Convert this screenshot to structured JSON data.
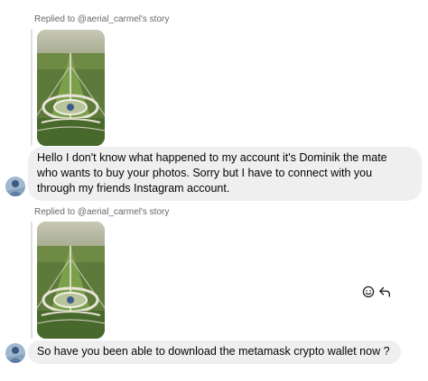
{
  "messages": [
    {
      "reply_label": "Replied to @aerial_carmel's story",
      "story_image": "aerial-park-photo",
      "text": "Hello I don't know what happened to my account it's Dominik the mate who wants to buy your photos. Sorry but I have to connect with you through my friends Instagram account.",
      "avatar": "user-avatar"
    },
    {
      "reply_label": "Replied to @aerial_carmel's story",
      "story_image": "aerial-park-photo",
      "text": "So have you been able to download the metamask crypto wallet now ?",
      "avatar": "user-avatar",
      "actions": [
        "emoji-react-icon",
        "reply-arrow-icon"
      ]
    }
  ],
  "colors": {
    "bubble_bg": "#efefef",
    "label_text": "#65676b",
    "reply_bar": "#dfe1e4"
  }
}
